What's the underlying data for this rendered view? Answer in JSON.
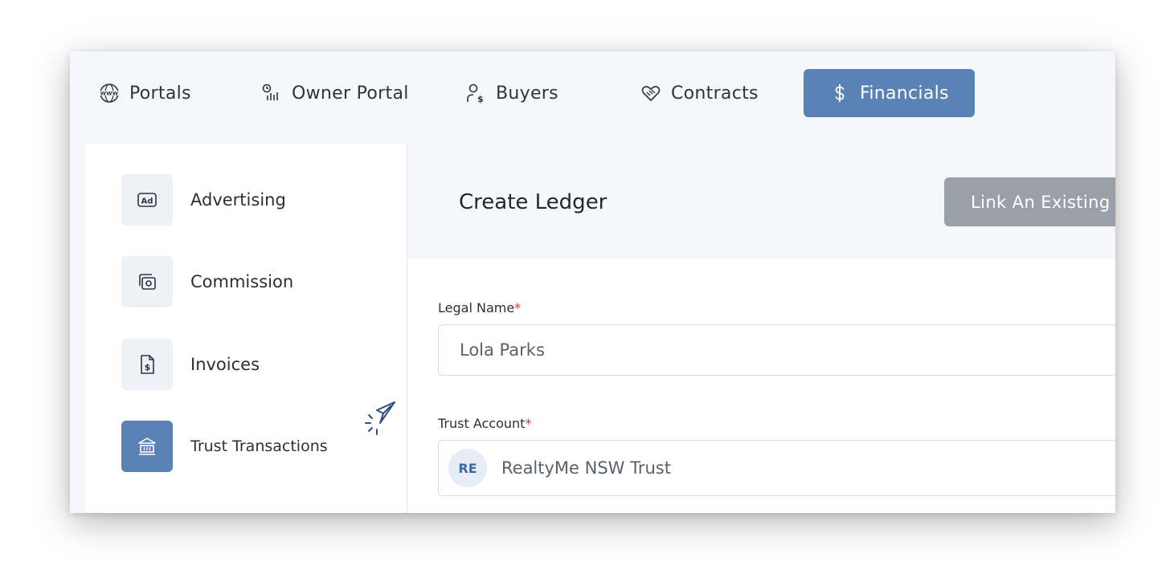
{
  "topnav": {
    "tabs": [
      {
        "label": "Portals",
        "icon": "www-globe-icon"
      },
      {
        "label": "Owner Portal",
        "icon": "owner-portal-icon"
      },
      {
        "label": "Buyers",
        "icon": "buyer-person-icon"
      },
      {
        "label": "Contracts",
        "icon": "handshake-heart-icon"
      },
      {
        "label": "Financials",
        "icon": "dollar-icon",
        "active": true
      }
    ]
  },
  "sidebar": {
    "items": [
      {
        "label": "Advertising",
        "icon": "ad-icon"
      },
      {
        "label": "Commission",
        "icon": "cash-icon"
      },
      {
        "label": "Invoices",
        "icon": "invoice-dollar-icon"
      },
      {
        "label": "Trust Transactions",
        "icon": "bank-icon",
        "active": true
      }
    ]
  },
  "header": {
    "title": "Create Ledger",
    "link_button": "Link An Existing"
  },
  "form": {
    "legal_name": {
      "label": "Legal Name",
      "required_mark": "*",
      "value": "Lola Parks"
    },
    "trust_account": {
      "label": "Trust Account",
      "required_mark": "*",
      "badge": "RE",
      "value": "RealtyMe NSW Trust"
    }
  },
  "colors": {
    "accent": "#5a82b4",
    "required": "#e0322f",
    "disabled_button": "#9aa0a8"
  }
}
